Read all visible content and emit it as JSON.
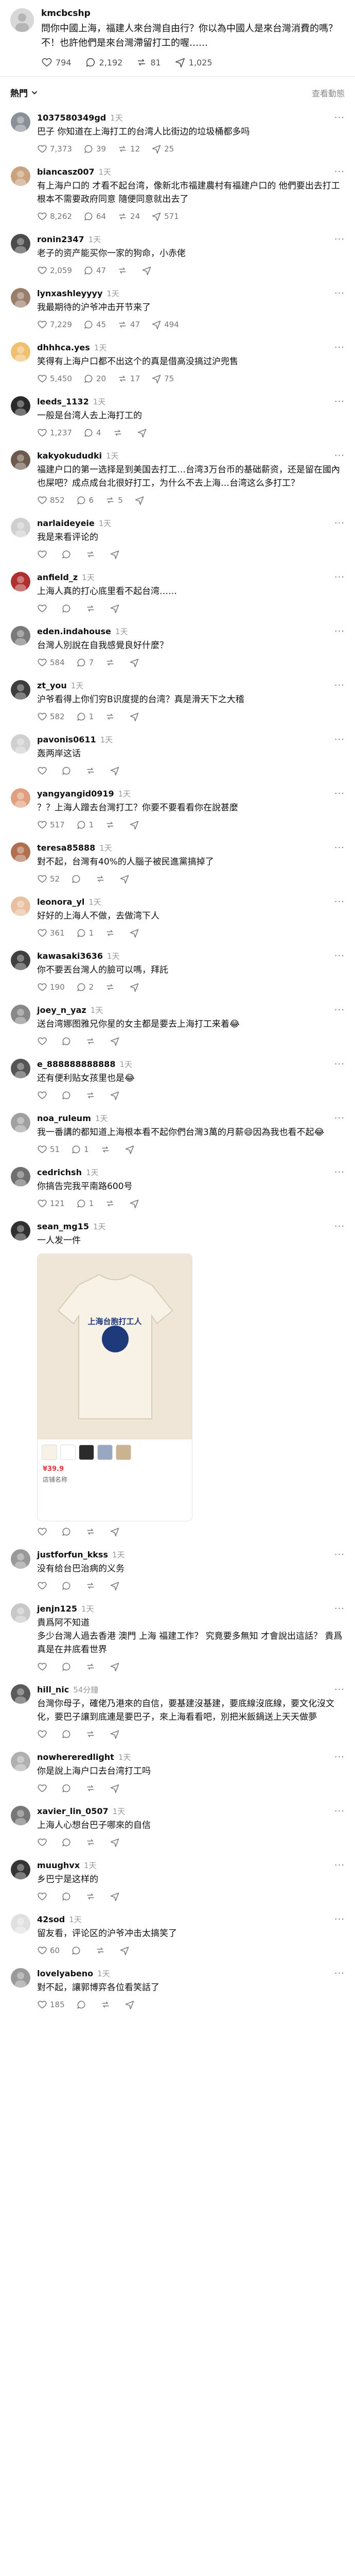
{
  "post": {
    "username": "kmcbcshp",
    "text": "問你中國上海，福建人來台灣自由行？你以為中國人是來台灣消費的嗎？不！也許他們是來台灣滯留打工的喔……",
    "likes": "794",
    "comments": "2,192",
    "reposts": "81",
    "shares": "1,025",
    "avatar_color": "#d8d8d8"
  },
  "sort": {
    "label": "熱門",
    "activity": "查看動態"
  },
  "comments": [
    {
      "user": "1037580349gd",
      "time": "1天",
      "text": "巴子 你知道在上海打工的台湾人比街边的垃圾桶都多吗",
      "likes": "7,373",
      "replies": "39",
      "reposts": "12",
      "shares": "25",
      "avatar": "#8a8f98"
    },
    {
      "user": "biancasz007",
      "time": "1天",
      "text": "有上海户口的 才看不起台湾，像新北市福建農村有福建户口的 他們要出去打工 根本不需要政府同意 隨便同意就出去了",
      "likes": "8,262",
      "replies": "64",
      "reposts": "24",
      "shares": "571",
      "avatar": "#c9a27e"
    },
    {
      "user": "ronin2347",
      "time": "1天",
      "text": "老子的资产能买你一家的狗命，小赤佬",
      "likes": "2,059",
      "replies": "47",
      "reposts": "",
      "shares": "",
      "avatar": "#4b4b4b"
    },
    {
      "user": "lynxashleyyyy",
      "time": "1天",
      "text": "我最期待的沪爷冲击开节来了",
      "likes": "7,229",
      "replies": "45",
      "reposts": "47",
      "shares": "494",
      "avatar": "#9a7d6b"
    },
    {
      "user": "dhhhca.yes",
      "time": "1天",
      "text": "笑得有上海户口都不出这个的真是借高没搞过沪兜售",
      "likes": "5,450",
      "replies": "20",
      "reposts": "17",
      "shares": "75",
      "avatar": "#f0c070"
    },
    {
      "user": "leeds_1132",
      "time": "1天",
      "text": "一般是台湾人去上海打工的",
      "likes": "1,237",
      "replies": "4",
      "reposts": "",
      "shares": "",
      "avatar": "#2a2a2a"
    },
    {
      "user": "kakyokududki",
      "time": "1天",
      "text": "福建户口的第一选择是到美国去打工…台湾3万台币的基础薪资，还是留在國內也屎吧？成点成台北很好打工，为什么不去上海…台湾这么多打工？",
      "likes": "852",
      "replies": "6",
      "reposts": "5",
      "shares": "",
      "avatar": "#6c5a4e"
    },
    {
      "user": "narlaideyeie",
      "time": "1天",
      "text": "我是来看评论的",
      "likes": "",
      "replies": "",
      "reposts": "",
      "shares": "",
      "avatar": "#cfcfcf"
    },
    {
      "user": "anfield_z",
      "time": "1天",
      "text": "上海人真的打心底里看不起台湾……",
      "likes": "",
      "replies": "",
      "reposts": "",
      "shares": "",
      "avatar": "#b03030"
    },
    {
      "user": "eden.indahouse",
      "time": "1天",
      "text": "台灣人別說在自我感覺良好什麼？",
      "likes": "584",
      "replies": "7",
      "reposts": "",
      "shares": "",
      "avatar": "#7a7a7a"
    },
    {
      "user": "zt_you",
      "time": "1天",
      "text": "沪爷看得上你们穷B识度提的台湾？真是滑天下之大稽",
      "likes": "582",
      "replies": "1",
      "reposts": "",
      "shares": "",
      "avatar": "#3d3d3d"
    },
    {
      "user": "pavonis0611",
      "time": "1天",
      "text": "轰两岸这话",
      "likes": "",
      "replies": "",
      "reposts": "",
      "shares": "",
      "avatar": "#d0d0d0"
    },
    {
      "user": "yangyangid0919",
      "time": "1天",
      "text": "？？上海人蹭去台灣打工？你要不要看看你在說甚麼",
      "likes": "517",
      "replies": "1",
      "reposts": "",
      "shares": "",
      "avatar": "#e0a080"
    },
    {
      "user": "teresa85888",
      "time": "1天",
      "text": "對不起，台灣有40%的人腦子被民進黨搞掉了",
      "likes": "52",
      "replies": "",
      "reposts": "",
      "shares": "",
      "avatar": "#b07050"
    },
    {
      "user": "leonora_yl",
      "time": "1天",
      "text": "好好的上海人不做，去做湾下人",
      "likes": "361",
      "replies": "1",
      "reposts": "",
      "shares": "",
      "avatar": "#e8c0a0"
    },
    {
      "user": "kawasaki3636",
      "time": "1天",
      "text": "你不要丟台灣人的臉可以嗎，拜託",
      "likes": "190",
      "replies": "2",
      "reposts": "",
      "shares": "",
      "avatar": "#404040"
    },
    {
      "user": "joey_n_yaz",
      "time": "1天",
      "text": "送台湾娜图雅兄你星的女主都是要去上海打工来着😂",
      "likes": "",
      "replies": "",
      "reposts": "",
      "shares": "",
      "avatar": "#888888"
    },
    {
      "user": "e_888888888888",
      "time": "1天",
      "text": "还有便利贴女孩里也是😂",
      "likes": "",
      "replies": "",
      "reposts": "",
      "shares": "",
      "avatar": "#555555"
    },
    {
      "user": "noa_ruleum",
      "time": "1天",
      "text": "我一番講的都知道上海根本看不起你們台灣3萬的月薪😄因為我也看不起😂",
      "likes": "51",
      "replies": "1",
      "reposts": "",
      "shares": "",
      "avatar": "#a0a0a0"
    },
    {
      "user": "cedrichsh",
      "time": "1天",
      "text": "你搞告完我平南路600号",
      "likes": "121",
      "replies": "1",
      "reposts": "",
      "shares": "",
      "avatar": "#6f6f6f"
    },
    {
      "user": "sean_mg15",
      "time": "1天",
      "text": "一人发一件",
      "likes": "",
      "replies": "",
      "reposts": "",
      "shares": "",
      "avatar": "#303030",
      "attachment": {
        "shirt_title": "上海台胞打工人",
        "price": "¥39.9",
        "shop": "店铺名称"
      }
    },
    {
      "user": "justforfun_kkss",
      "time": "1天",
      "text": "没有给台巴治病的义务",
      "likes": "",
      "replies": "",
      "reposts": "",
      "shares": "",
      "avatar": "#999999"
    },
    {
      "user": "jenjn125",
      "time": "1天",
      "text": "貴爲阿不知道\n多少台灣人過去香港 澳門 上海 福建工作？ 究竟要多無知 才會說出這話？ 貴爲真是在井底看世界",
      "likes": "",
      "replies": "",
      "reposts": "",
      "shares": "",
      "avatar": "#c8c8c8"
    },
    {
      "user": "hill_nic",
      "time": "54分鐘",
      "text": "台灣你母子，確佬乃港來的自信，要基建沒基建，要底線沒底線，要文化沒文化，要巴子讓到底連是要巴子，來上海看看吧，別把米飯鍋送上天天做夢",
      "likes": "",
      "replies": "",
      "reposts": "",
      "shares": "",
      "avatar": "#5a5a5a"
    },
    {
      "user": "nowhereredlight",
      "time": "1天",
      "text": "你是說上海户口去台湾打工吗",
      "likes": "",
      "replies": "",
      "reposts": "",
      "shares": "",
      "avatar": "#b0b0b0"
    },
    {
      "user": "xavier_lin_0507",
      "time": "1天",
      "text": "上海人心想台巴子哪來的自信",
      "likes": "",
      "replies": "",
      "reposts": "",
      "shares": "",
      "avatar": "#777777"
    },
    {
      "user": "muughvx",
      "time": "1天",
      "text": "乡巴宁是这样的",
      "likes": "",
      "replies": "",
      "reposts": "",
      "shares": "",
      "avatar": "#353535"
    },
    {
      "user": "42sod",
      "time": "1天",
      "text": "留友看，评论区的沪爷冲击太搞笑了",
      "likes": "60",
      "replies": "",
      "reposts": "",
      "shares": "",
      "avatar": "#e0e0e0"
    },
    {
      "user": "lovelyabeno",
      "time": "1天",
      "text": "對不起，讓郭博弈各位看笑話了",
      "likes": "185",
      "replies": "",
      "reposts": "",
      "shares": "",
      "avatar": "#9a9a9a"
    }
  ],
  "colors": {
    "text": "#101010",
    "muted": "#999999",
    "divider": "#e3e3e3"
  },
  "icons": {
    "like": "heart-icon",
    "reply": "comment-icon",
    "repost": "repost-icon",
    "share": "share-icon",
    "more": "more-icon",
    "sort": "chevron-down-icon"
  }
}
